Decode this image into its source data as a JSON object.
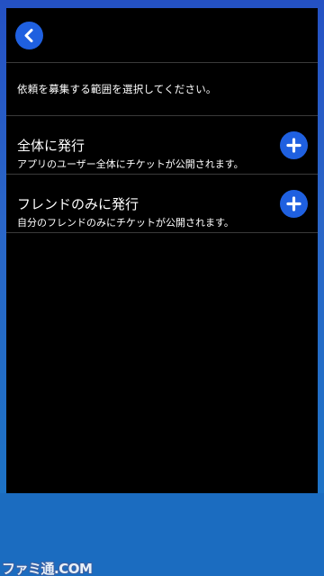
{
  "header": {
    "back_icon": "chevron-left-icon"
  },
  "instruction": {
    "text": "依頼を募集する範囲を選択してください。"
  },
  "options": [
    {
      "title": "全体に発行",
      "description": "アプリのユーザー全体にチケットが公開されます。",
      "icon": "plus-icon"
    },
    {
      "title": "フレンドのみに発行",
      "description": "自分のフレンドのみにチケットが公開されます。",
      "icon": "plus-icon"
    }
  ],
  "watermark": {
    "text": "ファミ通.COM"
  },
  "colors": {
    "accent": "#1f60e0",
    "screen_background": "#000000",
    "frame": "#2a66c8",
    "divider": "#3a3a3a"
  }
}
